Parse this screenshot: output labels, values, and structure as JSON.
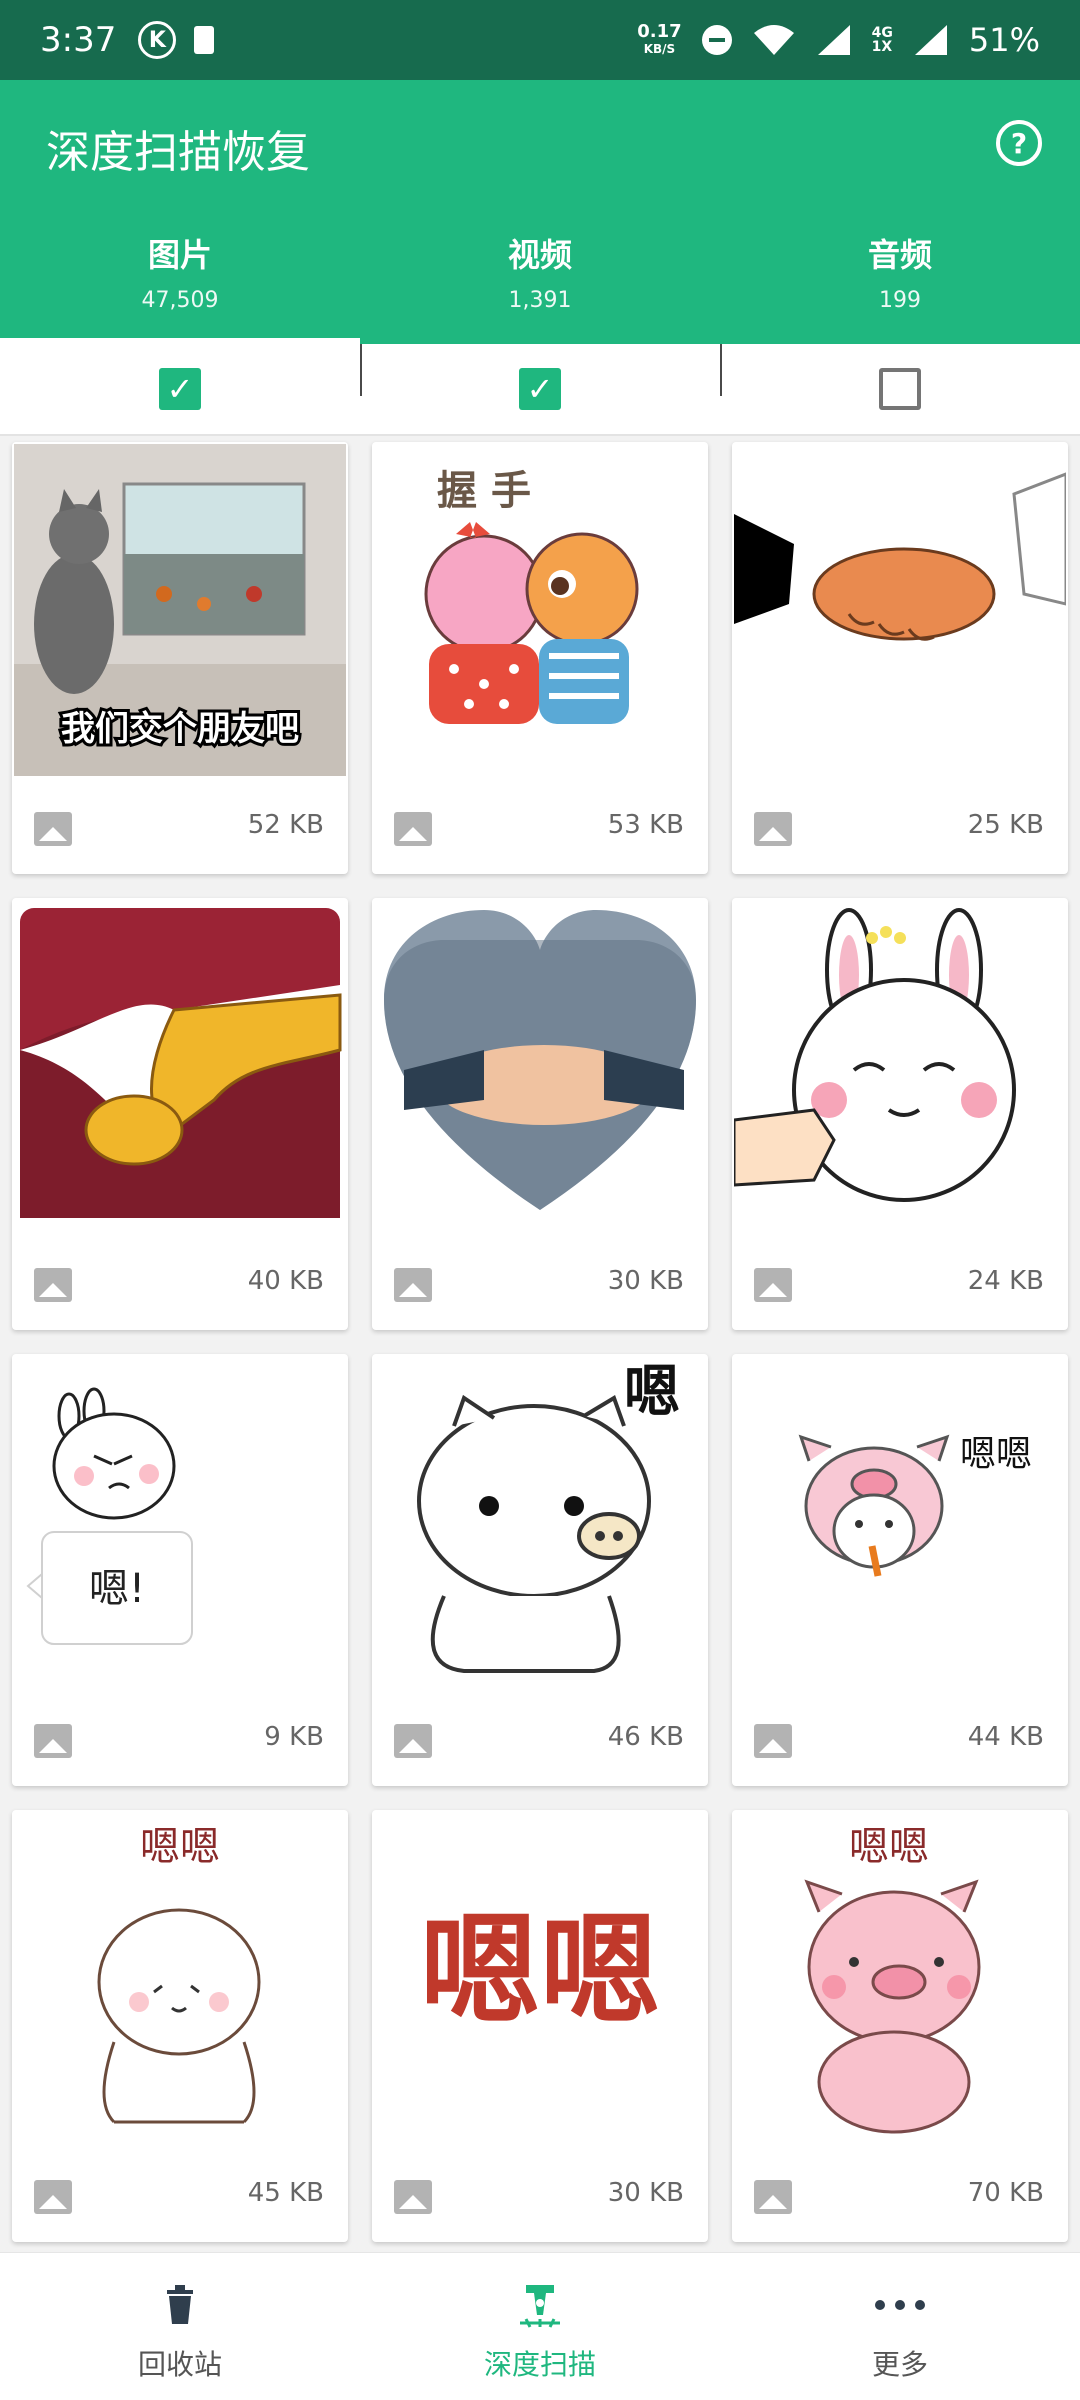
{
  "status": {
    "time": "3:37",
    "k_badge": "K",
    "speed_value": "0.17",
    "speed_unit": "KB/S",
    "network_gen": "4G",
    "network_sub": "1X",
    "battery": "51%"
  },
  "appbar": {
    "title": "深度扫描恢复",
    "help_glyph": "?"
  },
  "tabs": [
    {
      "label": "图片",
      "count": "47,509",
      "checked": true
    },
    {
      "label": "视频",
      "count": "1,391",
      "checked": true
    },
    {
      "label": "音频",
      "count": "199",
      "checked": false
    }
  ],
  "checkmark": "✓",
  "items": [
    {
      "size": "52 KB",
      "thumb": "cat-aquarium",
      "caption": "我们交个朋友吧"
    },
    {
      "size": "53 KB",
      "thumb": "cartoon-handshake",
      "caption": "握 手"
    },
    {
      "size": "25 KB",
      "thumb": "business-handshake"
    },
    {
      "size": "40 KB",
      "thumb": "gold-hands-red"
    },
    {
      "size": "30 KB",
      "thumb": "heart-handshake"
    },
    {
      "size": "24 KB",
      "thumb": "bunny-hand"
    },
    {
      "size": "9 KB",
      "thumb": "bunny-bubble",
      "caption": "嗯!"
    },
    {
      "size": "46 KB",
      "thumb": "pig-outline",
      "caption": "嗯"
    },
    {
      "size": "44 KB",
      "thumb": "pig-hood",
      "caption": "嗯嗯"
    },
    {
      "size": "45 KB",
      "thumb": "blob-character",
      "caption": "嗯嗯"
    },
    {
      "size": "30 KB",
      "thumb": "big-en-text",
      "caption": "嗯嗯"
    },
    {
      "size": "70 KB",
      "thumb": "pink-pig",
      "caption": "嗯嗯"
    }
  ],
  "bottom_nav": [
    {
      "label": "回收站",
      "icon": "trash-icon"
    },
    {
      "label": "深度扫描",
      "icon": "scan-icon",
      "active": true
    },
    {
      "label": "更多",
      "icon": "more-icon"
    }
  ],
  "colors": {
    "status_bar": "#176b4e",
    "primary": "#1fb77f",
    "checkbox_off": "#757575"
  }
}
